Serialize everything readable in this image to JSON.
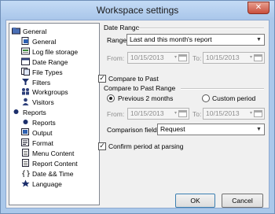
{
  "window": {
    "title": "Workspace settings",
    "close_glyph": "✕"
  },
  "tree": {
    "items": [
      {
        "label": "General",
        "icon": "folder-icon",
        "level": 0
      },
      {
        "label": "General",
        "icon": "page-icon",
        "level": 1
      },
      {
        "label": "Log file storage",
        "icon": "storage-icon",
        "level": 1
      },
      {
        "label": "Date Range",
        "icon": "calendar-icon",
        "level": 1
      },
      {
        "label": "File Types",
        "icon": "file-types-icon",
        "level": 1
      },
      {
        "label": "Filters",
        "icon": "filter-icon",
        "level": 1
      },
      {
        "label": "Workgroups",
        "icon": "workgroups-icon",
        "level": 1
      },
      {
        "label": "Visitors",
        "icon": "visitors-icon",
        "level": 1
      },
      {
        "label": "Reports",
        "icon": "reports-icon",
        "level": 0
      },
      {
        "label": "Reports",
        "icon": "reports-icon",
        "level": 1
      },
      {
        "label": "Output",
        "icon": "output-icon",
        "level": 1
      },
      {
        "label": "Format",
        "icon": "format-icon",
        "level": 1
      },
      {
        "label": "Menu Content",
        "icon": "document-icon",
        "level": 1
      },
      {
        "label": "Report Content",
        "icon": "document-icon",
        "level": 1
      },
      {
        "label": "Date && Time",
        "icon": "braces-icon",
        "level": 1
      },
      {
        "label": "Language",
        "icon": "language-icon",
        "level": 1
      }
    ]
  },
  "date_range": {
    "group_label": "Date Range",
    "range_label": "Range:",
    "range_value": "Last and this month's report",
    "from_label": "From:",
    "from_value": "10/15/2013",
    "to_label": "To:",
    "to_value": "10/15/2013"
  },
  "compare": {
    "checkbox_label": "Compare to Past",
    "checked": true,
    "group_label": "Compare to Past Range",
    "option_previous": "Previous 2 months",
    "option_custom": "Custom period",
    "selected": "previous",
    "from_label": "From:",
    "from_value": "10/15/2013",
    "to_label": "To:",
    "to_value": "10/15/2013",
    "field_label": "Comparison field:",
    "field_value": "Request"
  },
  "confirm": {
    "label": "Confirm period at parsing",
    "checked": true
  },
  "buttons": {
    "ok": "OK",
    "cancel": "Cancel"
  },
  "glyphs": {
    "check": "✓",
    "dropdown": "▼",
    "small_dropdown": "▾"
  }
}
